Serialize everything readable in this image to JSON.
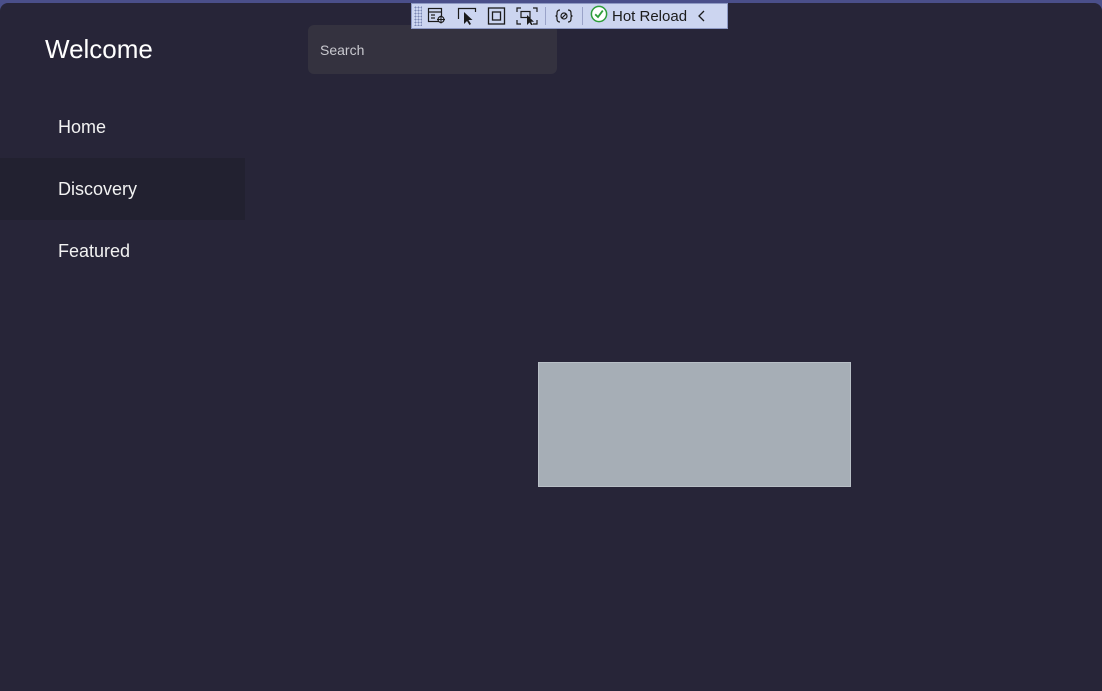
{
  "header": {
    "title": "Welcome"
  },
  "search": {
    "placeholder": "Search"
  },
  "nav": {
    "items": [
      {
        "label": "Home"
      },
      {
        "label": "Discovery"
      },
      {
        "label": "Featured"
      }
    ],
    "active_index": 1
  },
  "toolbar": {
    "icons": [
      "live-visual-tree-icon",
      "select-element-icon",
      "display-layout-adorners-icon",
      "track-focus-icon",
      "binding-failures-icon",
      "collapse-icon"
    ],
    "hot_reload_label": "Hot Reload",
    "hot_reload_status": "success"
  },
  "colors": {
    "window_bg": "#272538",
    "nav_active_bg": "#222130",
    "search_bg": "#34323f",
    "placeholder_box": "#a6aeb6",
    "toolbar_bg": "#ccd5f0",
    "hot_reload_ok": "#2e9e3a"
  }
}
